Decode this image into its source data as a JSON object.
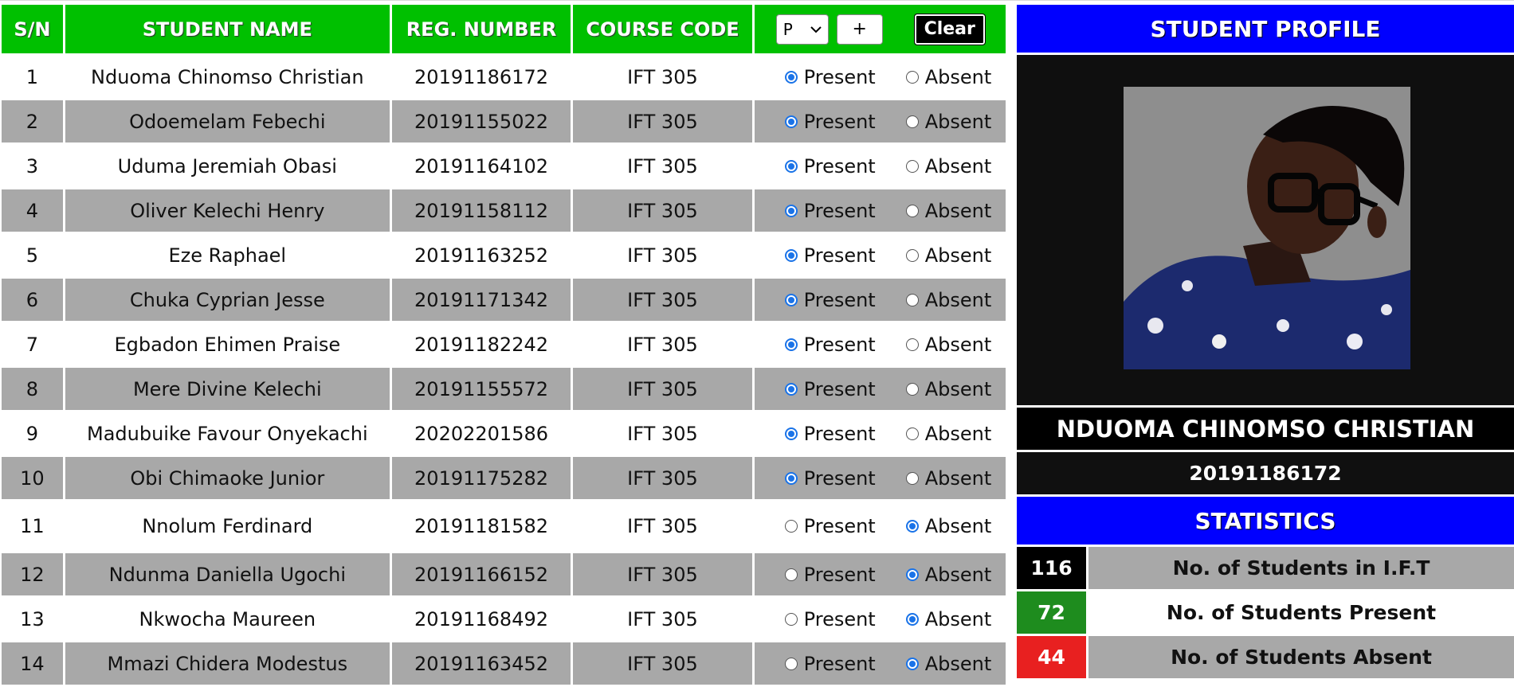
{
  "table": {
    "headers": {
      "sn": "S/N",
      "name": "STUDENT NAME",
      "reg": "REG. NUMBER",
      "course": "COURSE CODE"
    },
    "controls": {
      "select_value": "P",
      "plus_label": "+",
      "clear_label": "Clear"
    },
    "option_present": "Present",
    "option_absent": "Absent",
    "rows": [
      {
        "sn": "1",
        "name": "Nduoma Chinomso Christian",
        "reg": "20191186172",
        "course": "IFT 305",
        "status": "present"
      },
      {
        "sn": "2",
        "name": "Odoemelam Febechi",
        "reg": "20191155022",
        "course": "IFT 305",
        "status": "present"
      },
      {
        "sn": "3",
        "name": "Uduma Jeremiah Obasi",
        "reg": "20191164102",
        "course": "IFT 305",
        "status": "present"
      },
      {
        "sn": "4",
        "name": "Oliver Kelechi Henry",
        "reg": "20191158112",
        "course": "IFT 305",
        "status": "present"
      },
      {
        "sn": "5",
        "name": "Eze Raphael",
        "reg": "20191163252",
        "course": "IFT 305",
        "status": "present"
      },
      {
        "sn": "6",
        "name": "Chuka Cyprian Jesse",
        "reg": "20191171342",
        "course": "IFT 305",
        "status": "present"
      },
      {
        "sn": "7",
        "name": "Egbadon Ehimen Praise",
        "reg": "20191182242",
        "course": "IFT 305",
        "status": "present"
      },
      {
        "sn": "8",
        "name": "Mere Divine Kelechi",
        "reg": "20191155572",
        "course": "IFT 305",
        "status": "present"
      },
      {
        "sn": "9",
        "name": "Madubuike Favour Onyekachi",
        "reg": "20202201586",
        "course": "IFT 305",
        "status": "present"
      },
      {
        "sn": "10",
        "name": "Obi Chimaoke Junior",
        "reg": "20191175282",
        "course": "IFT 305",
        "status": "present"
      },
      {
        "sn": "11",
        "name": "Nnolum Ferdinard",
        "reg": "20191181582",
        "course": "IFT 305",
        "status": "absent"
      },
      {
        "sn": "12",
        "name": "Ndunma Daniella Ugochi",
        "reg": "20191166152",
        "course": "IFT 305",
        "status": "absent"
      },
      {
        "sn": "13",
        "name": "Nkwocha Maureen",
        "reg": "20191168492",
        "course": "IFT 305",
        "status": "absent"
      },
      {
        "sn": "14",
        "name": "Mmazi Chidera Modestus",
        "reg": "20191163452",
        "course": "IFT 305",
        "status": "absent"
      }
    ]
  },
  "profile": {
    "title": "STUDENT PROFILE",
    "name": "NDUOMA CHINOMSO CHRISTIAN",
    "reg": "20191186172"
  },
  "statistics": {
    "title": "STATISTICS",
    "items": [
      {
        "value": "116",
        "label": "No. of Students in I.F.T",
        "color": "#000000",
        "label_bg": "#a8a8a8"
      },
      {
        "value": "72",
        "label": "No. of Students Present",
        "color": "#1e8c1e",
        "label_bg": "#ffffff"
      },
      {
        "value": "44",
        "label": "No. of Students Absent",
        "color": "#e82020",
        "label_bg": "#a8a8a8"
      }
    ]
  },
  "colors": {
    "header_green": "#00c000",
    "profile_blue": "#0000ff",
    "row_gray": "#a8a8a8",
    "radio_blue": "#1a73e8"
  }
}
